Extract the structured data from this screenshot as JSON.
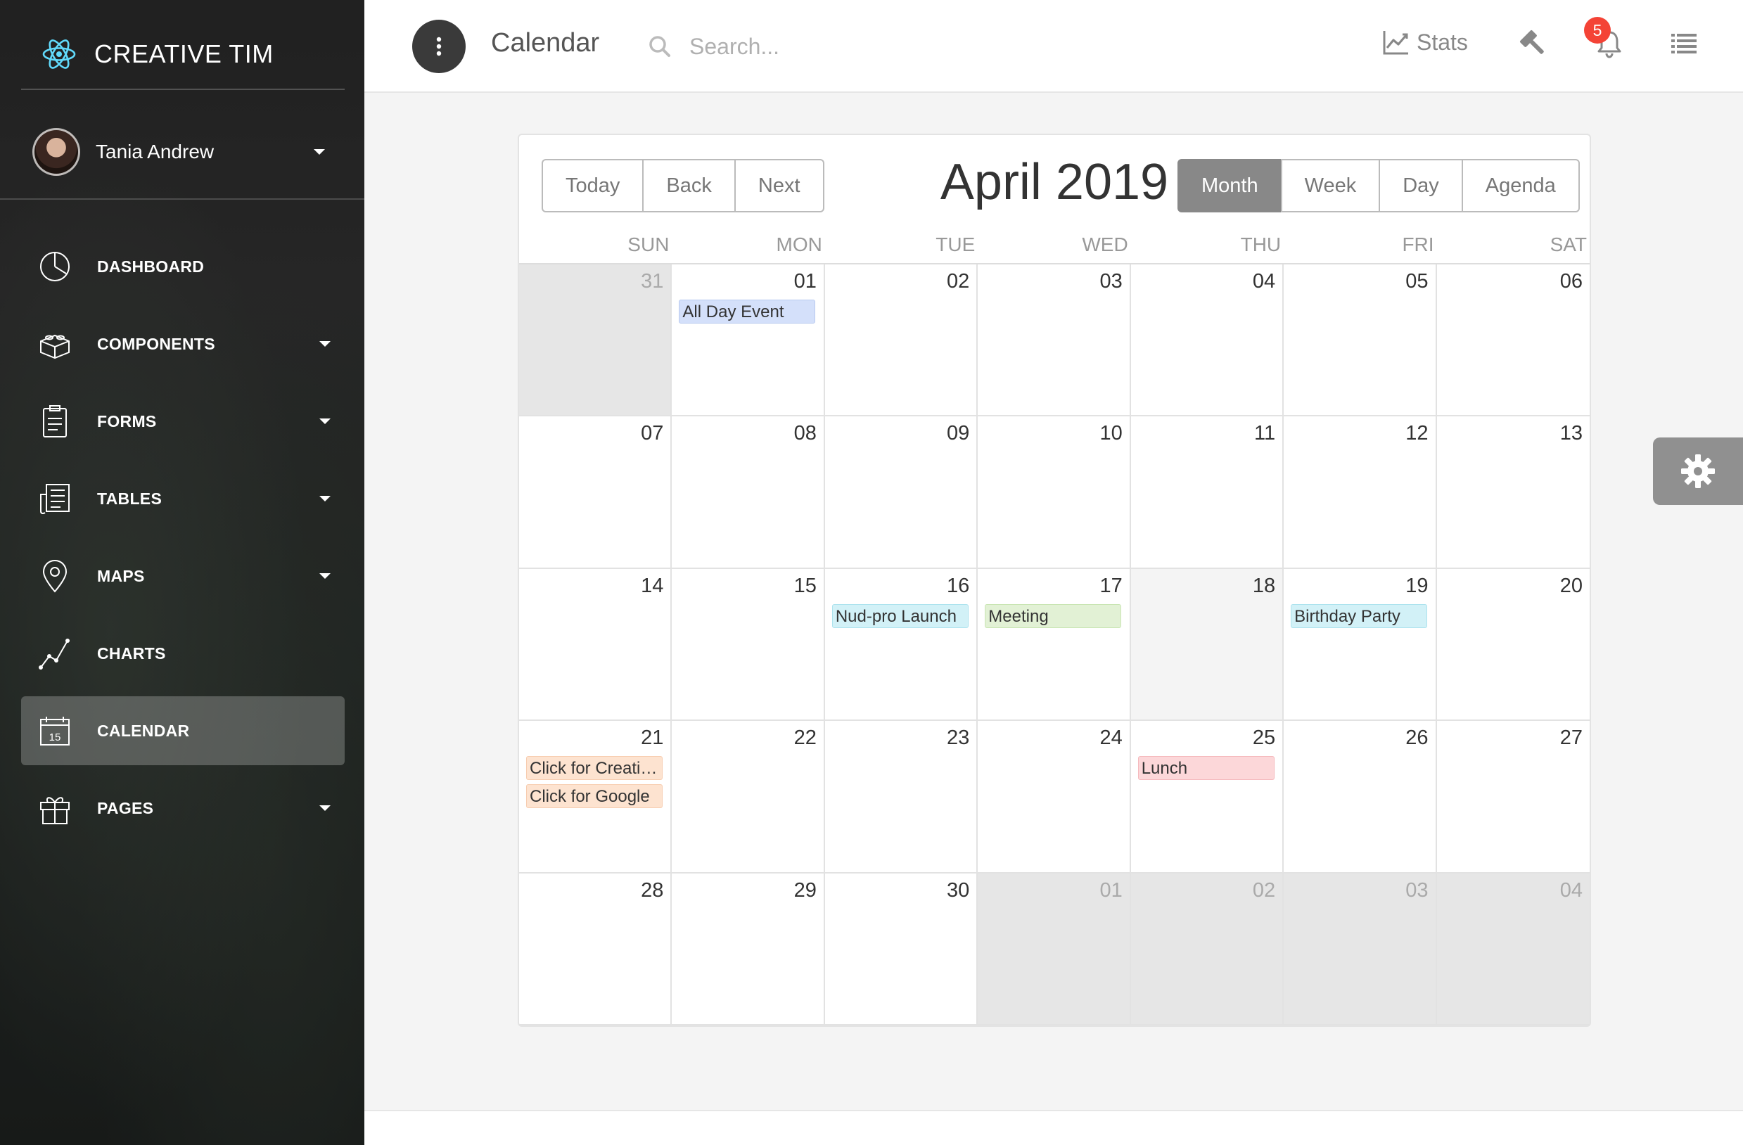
{
  "brand": {
    "name": "CREATIVE TIM"
  },
  "user": {
    "name": "Tania Andrew"
  },
  "nav": [
    {
      "label": "DASHBOARD",
      "icon": "pie-chart-icon",
      "caret": false,
      "active": false
    },
    {
      "label": "COMPONENTS",
      "icon": "lego-block-icon",
      "caret": true,
      "active": false
    },
    {
      "label": "FORMS",
      "icon": "clipboard-icon",
      "caret": true,
      "active": false
    },
    {
      "label": "TABLES",
      "icon": "newspaper-icon",
      "caret": true,
      "active": false
    },
    {
      "label": "MAPS",
      "icon": "map-pin-icon",
      "caret": true,
      "active": false
    },
    {
      "label": "CHARTS",
      "icon": "line-chart-icon",
      "caret": false,
      "active": false
    },
    {
      "label": "CALENDAR",
      "icon": "calendar-icon",
      "caret": false,
      "active": true
    },
    {
      "label": "PAGES",
      "icon": "gift-icon",
      "caret": true,
      "active": false
    }
  ],
  "calendar_icon_day": "15",
  "topbar": {
    "title": "Calendar",
    "search_placeholder": "Search...",
    "stats_label": "Stats",
    "notifications_count": "5"
  },
  "calendar": {
    "title": "April 2019",
    "nav_buttons": [
      "Today",
      "Back",
      "Next"
    ],
    "view_buttons": [
      "Month",
      "Week",
      "Day",
      "Agenda"
    ],
    "active_view": "Month",
    "weekdays": [
      "SUN",
      "MON",
      "TUE",
      "WED",
      "THU",
      "FRI",
      "SAT"
    ],
    "days": [
      {
        "num": "31",
        "off": true,
        "events": []
      },
      {
        "num": "01",
        "events": [
          {
            "title": "All Day Event",
            "color": "default"
          }
        ]
      },
      {
        "num": "02",
        "events": []
      },
      {
        "num": "03",
        "events": []
      },
      {
        "num": "04",
        "events": []
      },
      {
        "num": "05",
        "events": []
      },
      {
        "num": "06",
        "events": []
      },
      {
        "num": "07",
        "events": []
      },
      {
        "num": "08",
        "events": []
      },
      {
        "num": "09",
        "events": []
      },
      {
        "num": "10",
        "events": []
      },
      {
        "num": "11",
        "events": []
      },
      {
        "num": "12",
        "events": []
      },
      {
        "num": "13",
        "events": []
      },
      {
        "num": "14",
        "events": []
      },
      {
        "num": "15",
        "events": []
      },
      {
        "num": "16",
        "events": [
          {
            "title": "Nud-pro Launch",
            "color": "azure"
          }
        ]
      },
      {
        "num": "17",
        "events": [
          {
            "title": "Meeting",
            "color": "green"
          }
        ]
      },
      {
        "num": "18",
        "today": true,
        "events": []
      },
      {
        "num": "19",
        "events": [
          {
            "title": "Birthday Party",
            "color": "azure"
          }
        ]
      },
      {
        "num": "20",
        "events": []
      },
      {
        "num": "21",
        "events": [
          {
            "title": "Click for Creative Tim",
            "color": "orange"
          },
          {
            "title": "Click for Google",
            "color": "orange"
          }
        ]
      },
      {
        "num": "22",
        "events": []
      },
      {
        "num": "23",
        "events": []
      },
      {
        "num": "24",
        "events": []
      },
      {
        "num": "25",
        "events": [
          {
            "title": "Lunch",
            "color": "red"
          }
        ]
      },
      {
        "num": "26",
        "events": []
      },
      {
        "num": "27",
        "events": []
      },
      {
        "num": "28",
        "events": []
      },
      {
        "num": "29",
        "events": []
      },
      {
        "num": "30",
        "events": []
      },
      {
        "num": "01",
        "off": true,
        "events": []
      },
      {
        "num": "02",
        "off": true,
        "events": []
      },
      {
        "num": "03",
        "off": true,
        "events": []
      },
      {
        "num": "04",
        "off": true,
        "events": []
      }
    ]
  },
  "colors": {
    "accent_logo": "#61dafb",
    "badge": "#f44336",
    "active_button": "#888888"
  }
}
